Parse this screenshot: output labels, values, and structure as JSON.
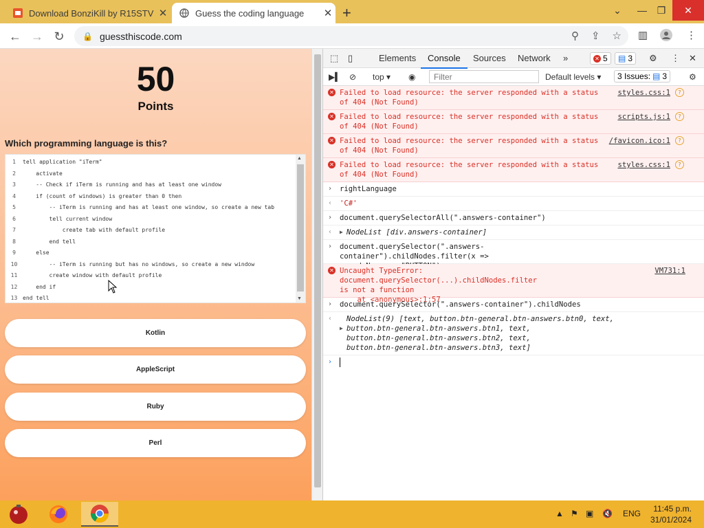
{
  "browser": {
    "tabs": [
      {
        "title": "Download BonziKill by R15STV -",
        "active": false
      },
      {
        "title": "Guess the coding language",
        "active": true
      }
    ],
    "url": "guessthiscode.com"
  },
  "game": {
    "points_value": "50",
    "points_label": "Points",
    "question": "Which programming language is this?",
    "code_lines": [
      {
        "n": "1",
        "text": "tell application \"iTerm\""
      },
      {
        "n": "2",
        "text": "    activate"
      },
      {
        "n": "3",
        "text": "    -- Check if iTerm is running and has at least one window"
      },
      {
        "n": "4",
        "text": "    if (count of windows) is greater than 0 then"
      },
      {
        "n": "5",
        "text": "        -- iTerm is running and has at least one window, so create a new tab"
      },
      {
        "n": "6",
        "text": "        tell current window"
      },
      {
        "n": "7",
        "text": "            create tab with default profile"
      },
      {
        "n": "8",
        "text": "        end tell"
      },
      {
        "n": "9",
        "text": "    else"
      },
      {
        "n": "10",
        "text": "        -- iTerm is running but has no windows, so create a new window"
      },
      {
        "n": "11",
        "text": "        create window with default profile"
      },
      {
        "n": "12",
        "text": "    end if"
      },
      {
        "n": "13",
        "text": "end tell"
      }
    ],
    "answers": [
      "Kotlin",
      "AppleScript",
      "Ruby",
      "Perl"
    ]
  },
  "devtools": {
    "tabs": [
      "Elements",
      "Console",
      "Sources",
      "Network"
    ],
    "active_tab": "Console",
    "error_count": "5",
    "message_count": "3",
    "context": "top",
    "filter_placeholder": "Filter",
    "levels": "Default levels",
    "issues_label": "3 Issues:",
    "issues_count": "3",
    "logs": [
      {
        "type": "error",
        "text": "Failed to load resource: the server responded with a status of 404 (Not Found)",
        "src": "styles.css:1"
      },
      {
        "type": "error",
        "text": "Failed to load resource: the server responded with a status of 404 (Not Found)",
        "src": "scripts.js:1"
      },
      {
        "type": "error",
        "text": "Failed to load resource: the server responded with a status of 404 (Not Found)",
        "src": "/favicon.ico:1"
      },
      {
        "type": "error",
        "text": "Failed to load resource: the server responded with a status of 404 (Not Found)",
        "src": "styles.css:1"
      },
      {
        "type": "input",
        "text": "rightLanguage"
      },
      {
        "type": "output",
        "text": "'C#'"
      },
      {
        "type": "input",
        "text": "document.querySelectorAll(\".answers-container\")"
      },
      {
        "type": "output-obj",
        "text": "NodeList [div.answers-container]"
      },
      {
        "type": "input",
        "text": "document.querySelector(\".answers-container\").childNodes.filter(x =>\nx.nodeName == \"BUTTON\")"
      },
      {
        "type": "error",
        "text": "Uncaught TypeError: document.querySelector(...).childNodes.filter\nis not a function\n    at <anonymous>:1:57",
        "src": "VM731:1"
      },
      {
        "type": "input",
        "text": "document.querySelector(\".answers-container\").childNodes"
      },
      {
        "type": "output-obj",
        "text": "NodeList(9) [text, button.btn-general.btn-answers.btn0, text,\nbutton.btn-general.btn-answers.btn1, text,\nbutton.btn-general.btn-answers.btn2, text,\nbutton.btn-general.btn-answers.btn3, text]"
      }
    ]
  },
  "taskbar": {
    "lang": "ENG",
    "time": "11:45 p.m.",
    "date": "31/01/2024"
  }
}
